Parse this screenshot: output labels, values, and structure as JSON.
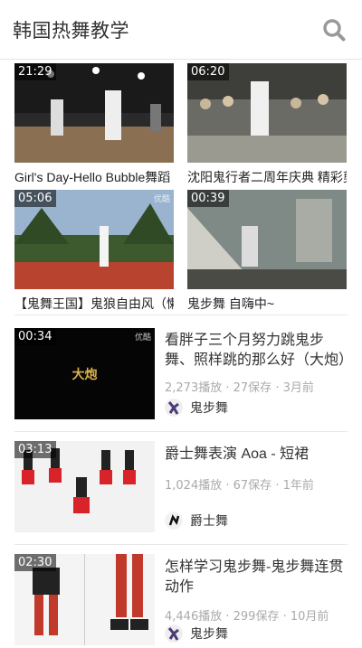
{
  "header": {
    "title": "韩国热舞教学",
    "search_icon": "search-icon"
  },
  "grid": [
    {
      "duration": "21:29",
      "caption": "Girl's Day-Hello Bubble舞蹈"
    },
    {
      "duration": "06:20",
      "caption": "沈阳鬼行者二周年庆典 精彩剪"
    },
    {
      "duration": "05:06",
      "caption": "【鬼舞王国】鬼狼自由风（懒.",
      "watermark": "优酷"
    },
    {
      "duration": "00:39",
      "caption": "鬼步舞 自嗨中~"
    }
  ],
  "list": [
    {
      "duration": "00:34",
      "watermark": "优酷",
      "thumb_text": "大炮",
      "title": "看胖子三个月努力跳鬼步舞、照样跳的那么好（大炮）",
      "plays": "2,273播放",
      "saves": "27保存",
      "time": "3月前",
      "author": "鬼步舞"
    },
    {
      "duration": "03:13",
      "title": "爵士舞表演 Aoa - 短裙",
      "plays": "1,024播放",
      "saves": "67保存",
      "time": "1年前",
      "author": "爵士舞"
    },
    {
      "duration": "02:30",
      "title": "怎样学习鬼步舞-鬼步舞连贯动作",
      "plays": "4,446播放",
      "saves": "299保存",
      "time": "10月前",
      "author": "鬼步舞"
    }
  ],
  "meta_sep": "·",
  "colors": {
    "accent": "#999999",
    "meta": "#aaaaaa",
    "divider": "#e8e8e8"
  }
}
